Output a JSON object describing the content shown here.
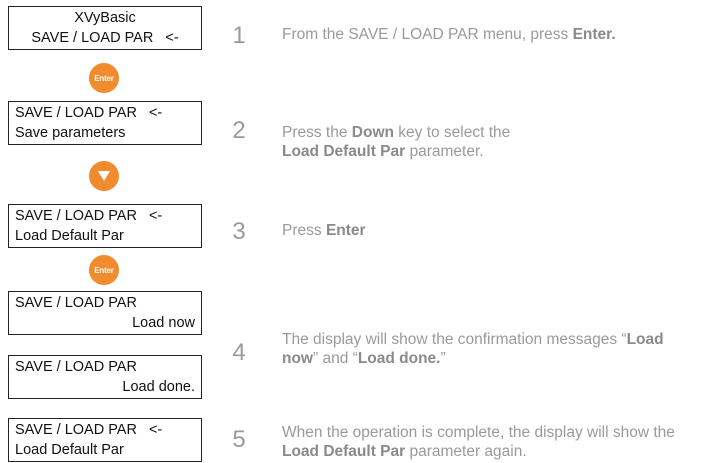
{
  "displays": [
    {
      "line1": "XVyBasic",
      "line2": "SAVE / LOAD PAR",
      "line2_cursor": "<-"
    },
    {
      "line1": "SAVE / LOAD PAR",
      "line1_cursor": "<-",
      "line2": "Save parameters"
    },
    {
      "line1": "SAVE / LOAD PAR",
      "line1_cursor": "<-",
      "line2": "Load Default Par"
    },
    {
      "line1": "SAVE / LOAD PAR",
      "line2": "Load now"
    },
    {
      "line1": "SAVE / LOAD PAR",
      "line2": "Load done."
    },
    {
      "line1": "SAVE / LOAD PAR",
      "line1_cursor": "<-",
      "line2": "Load Default Par"
    }
  ],
  "keys": {
    "enter_label": "Enter",
    "down_icon": "down-arrow-icon",
    "accent_color": "#f28a2e"
  },
  "steps": [
    {
      "number": "1",
      "parts": [
        "From the SAVE / LOAD PAR menu, press ",
        "Enter."
      ]
    },
    {
      "number": "2",
      "parts": [
        "Press the ",
        "Down",
        " key to select the ",
        "Load Default Par",
        " parameter."
      ]
    },
    {
      "number": "3",
      "parts": [
        "Press ",
        "Enter"
      ]
    },
    {
      "number": "4",
      "parts": [
        "The display will show the confirmation messages “",
        "Load now",
        "” and “",
        "Load done.",
        "”"
      ]
    },
    {
      "number": "5",
      "parts": [
        "When the operation is complete, the display will show the ",
        "Load Default Par",
        " parameter again."
      ]
    }
  ]
}
